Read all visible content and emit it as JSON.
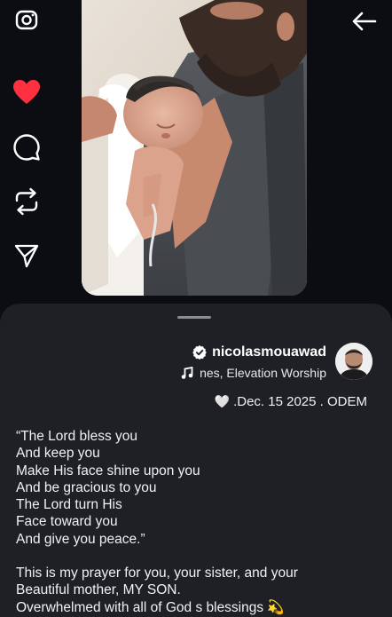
{
  "rail": {
    "camera_icon": "camera-icon",
    "like_icon": "heart-filled-icon",
    "comment_icon": "comment-icon",
    "repost_icon": "repost-icon",
    "share_icon": "send-icon",
    "like_color": "#ff3040"
  },
  "header": {
    "back_icon": "arrow-left-icon"
  },
  "post": {
    "username": "nicolasmouawad",
    "verified": true,
    "audio": "nes, Elevation Worship",
    "date_emoji": "🤍",
    "date_text": ".Dec. 15 2025 . ODEM",
    "caption_verse": [
      "“The Lord bless you",
      "And keep you",
      "Make His face shine upon you",
      "And be gracious to you",
      "The Lord turn His",
      "Face toward you",
      "And give you peace.”"
    ],
    "caption_prayer": [
      "This is my prayer for you, your sister, and your",
      "Beautiful mother, MY SON.",
      "Overwhelmed with all of God s blessings 💫"
    ]
  },
  "colors": {
    "background": "#0b0d12",
    "sheet": "#1f2025",
    "text": "#f1f1f3"
  }
}
